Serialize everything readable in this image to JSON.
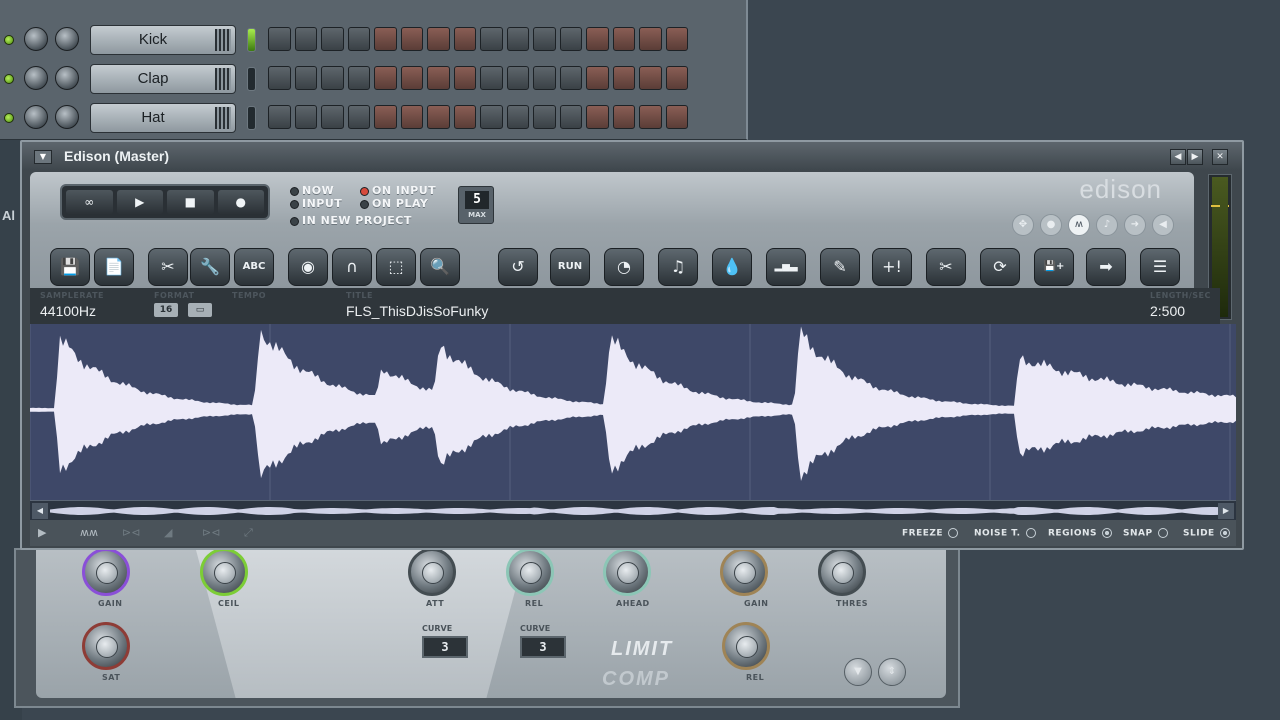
{
  "sequencer": {
    "channels": [
      {
        "name": "Kick",
        "selected": true
      },
      {
        "name": "Clap",
        "selected": false
      },
      {
        "name": "Hat",
        "selected": false
      }
    ]
  },
  "left_strip_text": "Al",
  "edison": {
    "title": "Edison (Master)",
    "logo": "edison",
    "transport": {
      "loop": "∞",
      "play": "▶",
      "stop": "■",
      "record": "●"
    },
    "record_options": {
      "now": "NOW",
      "input": "INPUT",
      "in_new_project": "IN NEW PROJECT",
      "on_input": "ON INPUT",
      "on_play": "ON PLAY"
    },
    "max": {
      "value": "5",
      "label": "MAX"
    },
    "tools": [
      {
        "name": "save-tool",
        "glyph": "💾"
      },
      {
        "name": "new-tool",
        "glyph": "📄"
      },
      {
        "name": "edit-tool",
        "glyph": "✂"
      },
      {
        "name": "tools-tool",
        "glyph": "🔧"
      },
      {
        "name": "regions-tool",
        "glyph": "ABC"
      },
      {
        "name": "view-tool",
        "glyph": "◉"
      },
      {
        "name": "snap-tool",
        "glyph": "∩"
      },
      {
        "name": "select-tool",
        "glyph": "⬚"
      },
      {
        "name": "zoom-tool",
        "glyph": "🔍"
      },
      {
        "name": "undo-tool",
        "glyph": "↺"
      },
      {
        "name": "run-tool",
        "glyph": "RUN"
      },
      {
        "name": "tempo-tool",
        "glyph": "◔"
      },
      {
        "name": "noise-tool",
        "glyph": "♫"
      },
      {
        "name": "eq-tool",
        "glyph": "💧"
      },
      {
        "name": "bars-tool",
        "glyph": "▂▅▃"
      },
      {
        "name": "pencil-tool",
        "glyph": "✎"
      },
      {
        "name": "add-marker-tool",
        "glyph": "+!"
      },
      {
        "name": "slice-tool",
        "glyph": "✂"
      },
      {
        "name": "loop-tool",
        "glyph": "⟳"
      },
      {
        "name": "save-as-tool",
        "glyph": "💾+"
      },
      {
        "name": "send-tool",
        "glyph": "➡"
      },
      {
        "name": "playlist-tool",
        "glyph": "☰"
      }
    ],
    "info": {
      "samplerate_label": "SAMPLERATE",
      "samplerate": "44100Hz",
      "format_label": "FORMAT",
      "format_bits": "16",
      "format_icon": "▭",
      "tempo_label": "TEMPO",
      "title_label": "TITLE",
      "title": "FLS_ThisDJisSoFunky",
      "length_label": "LENGTH/SEC",
      "length": "2:500"
    },
    "overview": {
      "left": "◀",
      "right": "▶"
    },
    "status": {
      "play_icon": "▶",
      "wave_icon": "ʍʍ",
      "icons_dim": [
        "⊳⊲",
        "◢",
        "⊳⊲",
        "⤢"
      ],
      "freeze": {
        "label": "FREEZE",
        "on": false
      },
      "noise": {
        "label": "NOISE T.",
        "on": false
      },
      "regions": {
        "label": "REGIONS",
        "on": true
      },
      "snap": {
        "label": "SNAP",
        "on": false
      },
      "slide": {
        "label": "SLIDE",
        "on": true
      }
    }
  },
  "limiter": {
    "labels": {
      "gain": "GAIN",
      "ceil": "CEIL",
      "sat": "SAT",
      "att": "ATT",
      "rel": "REL",
      "ahead": "AHEAD",
      "gain2": "GAIN",
      "thres": "THRES",
      "rel2": "REL",
      "curve1": "CURVE",
      "curve2": "CURVE"
    },
    "curve1_value": "3",
    "curve2_value": "3",
    "limit": "LIMIT",
    "comp": "COMP"
  },
  "colors": {
    "waveform": "#eceaf8",
    "wave_bg": "#3e4868",
    "sat_knob": "#8e3c36",
    "gain_knob": "#8a4fd8",
    "ceil_knob": "#7ccd36"
  }
}
